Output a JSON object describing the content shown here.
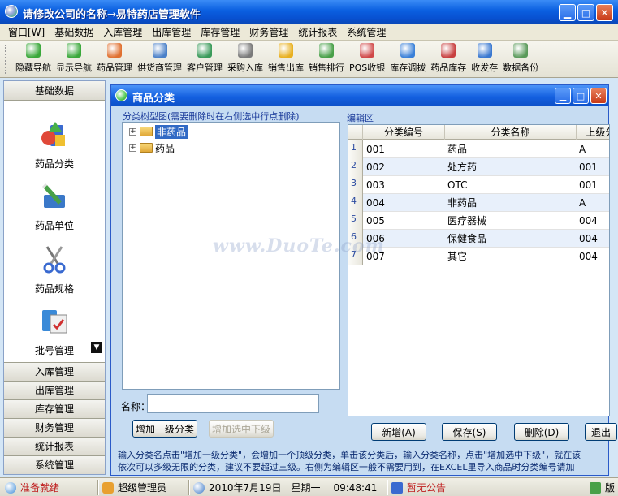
{
  "window": {
    "title": "请修改公司的名称→易特药店管理软件"
  },
  "menu": [
    "窗口[W]",
    "基础数据",
    "入库管理",
    "出库管理",
    "库存管理",
    "财务管理",
    "统计报表",
    "系统管理"
  ],
  "toolbar": [
    {
      "label": "隐藏导航",
      "icon": "arrow-left-icon",
      "color": "#3aa83a"
    },
    {
      "label": "显示导航",
      "icon": "arrow-right-icon",
      "color": "#3aa83a"
    },
    {
      "label": "药品管理",
      "icon": "pills-icon",
      "color": "#e07030"
    },
    {
      "label": "供货商管理",
      "icon": "supplier-icon",
      "color": "#4a80c8"
    },
    {
      "label": "客户管理",
      "icon": "customers-icon",
      "color": "#3a9a5a"
    },
    {
      "label": "采购入库",
      "icon": "cart-icon",
      "color": "#7a7a7a"
    },
    {
      "label": "销售出库",
      "icon": "star-icon",
      "color": "#e8b020"
    },
    {
      "label": "销售排行",
      "icon": "bar-chart-icon",
      "color": "#48a048"
    },
    {
      "label": "POS收银",
      "icon": "pos-icon",
      "color": "#d04848"
    },
    {
      "label": "库存调拨",
      "icon": "transfer-icon",
      "color": "#3a80d8"
    },
    {
      "label": "药品库存",
      "icon": "stock-icon",
      "color": "#c84040"
    },
    {
      "label": "收发存",
      "icon": "pie-chart-icon",
      "color": "#3a78d0"
    },
    {
      "label": "数据备份",
      "icon": "backup-icon",
      "color": "#5a9a5a"
    }
  ],
  "nav": {
    "header": "基础数据",
    "items": [
      "药品分类",
      "药品单位",
      "药品规格",
      "批号管理"
    ],
    "categories": [
      "入库管理",
      "出库管理",
      "库存管理",
      "财务管理",
      "统计报表",
      "系统管理"
    ]
  },
  "child": {
    "title": "商品分类",
    "tree_label": "分类树型图(需要删除时在右侧选中行点删除)",
    "tree": [
      {
        "label": "非药品",
        "selected": true
      },
      {
        "label": "药品",
        "selected": false
      }
    ],
    "name_label": "名称：",
    "name_value": "",
    "btn_add_top": "增加一级分类",
    "btn_add_child": "增加选中下级",
    "edit_label": "编辑区",
    "grid_headers": [
      "分类编号",
      "分类名称",
      "上级分"
    ],
    "grid_rows": [
      {
        "num": "1",
        "code": "001",
        "name": "药品",
        "parent": "A"
      },
      {
        "num": "2",
        "code": "002",
        "name": "处方药",
        "parent": "001"
      },
      {
        "num": "3",
        "code": "003",
        "name": "OTC",
        "parent": "001"
      },
      {
        "num": "4",
        "code": "004",
        "name": "非药品",
        "parent": "A"
      },
      {
        "num": "5",
        "code": "005",
        "name": "医疗器械",
        "parent": "004"
      },
      {
        "num": "6",
        "code": "006",
        "name": "保健食品",
        "parent": "004"
      },
      {
        "num": "7",
        "code": "007",
        "name": "其它",
        "parent": "004"
      }
    ],
    "btn_new": "新增(A)",
    "btn_save": "保存(S)",
    "btn_delete": "删除(D)",
    "btn_exit": "退出",
    "hint_line1": "输入分类名点击\"增加一级分类\"，会增加一个顶级分类，单击该分类后，输入分类名称，点击\"增加选中下级\"，就在该",
    "hint_line2": "依次可以多级无限的分类，建议不要超过三级。右侧为编辑区一般不需要用到，在EXCEL里导入商品时分类编号请加"
  },
  "watermark": "www.DuoTe.com",
  "status": {
    "ready": "准备就绪",
    "user": "超级管理员",
    "date": "2010年7月19日",
    "weekday": "星期一",
    "time": "09:48:41",
    "notice": "暂无公告",
    "version": "版"
  }
}
